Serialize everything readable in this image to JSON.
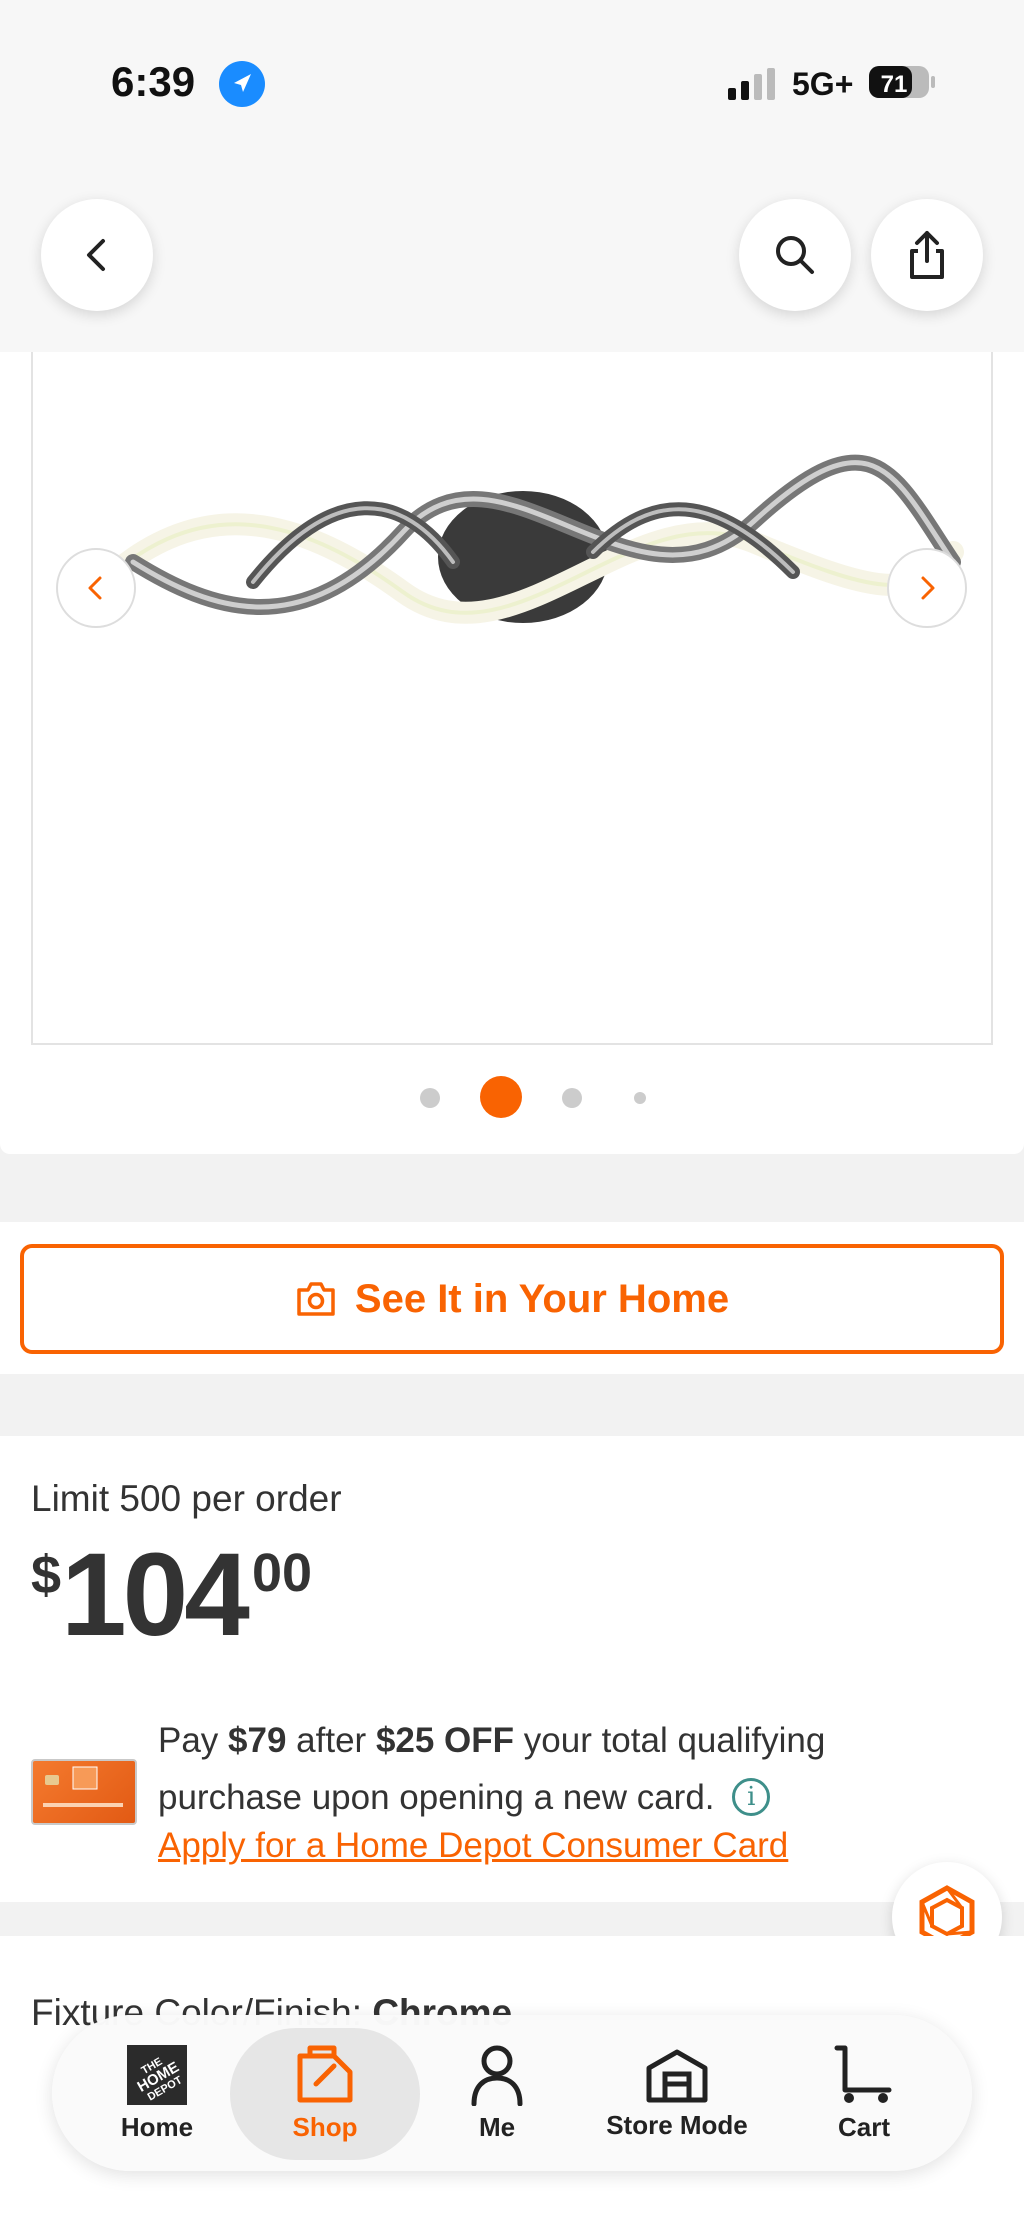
{
  "status_bar": {
    "time": "6:39",
    "network": "5G+",
    "battery": "71"
  },
  "header": {
    "back_icon": "chevron-left-icon",
    "search_icon": "search-icon",
    "share_icon": "share-icon"
  },
  "gallery": {
    "prev_icon": "chevron-left-icon",
    "next_icon": "chevron-right-icon",
    "active_index": 1,
    "count": 4
  },
  "ar_button": {
    "label": "See It in Your Home",
    "icon": "camera-icon"
  },
  "pricing": {
    "limit": "Limit 500 per order",
    "currency": "$",
    "dollars": "104",
    "cents": "00"
  },
  "promo": {
    "pay": "Pay ",
    "pay_amount": "$79",
    "after": " after ",
    "discount": "$25 OFF",
    "rest": " your total qualifying purchase upon opening a new card.",
    "info_glyph": "i",
    "link": "Apply for a Home Depot Consumer Card"
  },
  "fixture": {
    "label": "Fixture Color/Finish: ",
    "value": "Chrome"
  },
  "bottom_nav": {
    "tabs": [
      {
        "label": "Home",
        "icon": "home-depot-logo-icon"
      },
      {
        "label": "Shop",
        "icon": "shop-bag-icon",
        "active": true
      },
      {
        "label": "Me",
        "icon": "person-icon"
      },
      {
        "label": "Store Mode",
        "icon": "store-icon"
      },
      {
        "label": "Cart",
        "icon": "cart-icon"
      }
    ]
  },
  "colors": {
    "accent": "#f96302",
    "text": "#333333",
    "info": "#3e8f8a"
  }
}
